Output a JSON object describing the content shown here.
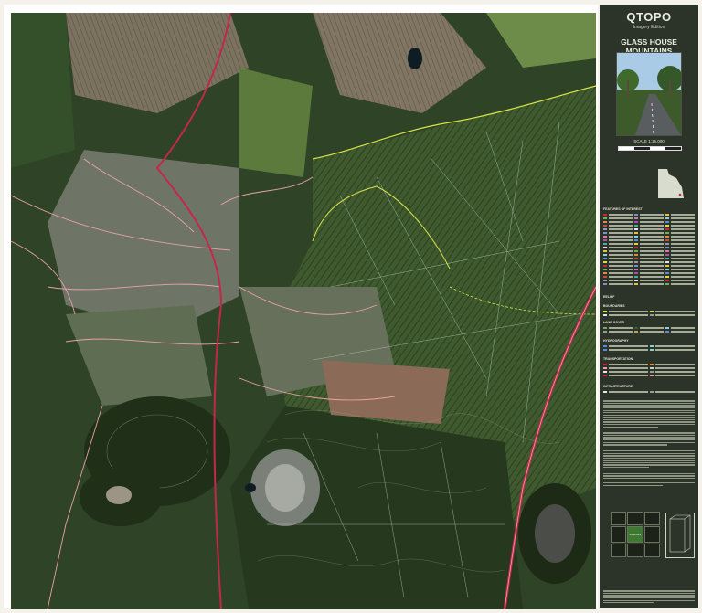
{
  "panel": {
    "brand": "QTOPO",
    "edition": "Imagery Edition",
    "title": "GLASS HOUSE MOUNTAINS",
    "sheet_number": "9444-221",
    "scale_label": "SCALE 1:15,000"
  },
  "colors": {
    "map_base": "#2a3a22",
    "road_major": "#c2284a",
    "road_minor": "#e8a1a8",
    "track": "#cfcfcf",
    "boundary": "#d9e24a",
    "panel_bg": "#2c3328"
  },
  "legend_sections": [
    "FEATURES OF INTEREST",
    "RELIEF",
    "BOUNDARIES",
    "LAND COVER",
    "HYDROGRAPHY",
    "TRANSPORTATION",
    "INFRASTRUCTURE"
  ],
  "index": {
    "center": "9444-221"
  }
}
